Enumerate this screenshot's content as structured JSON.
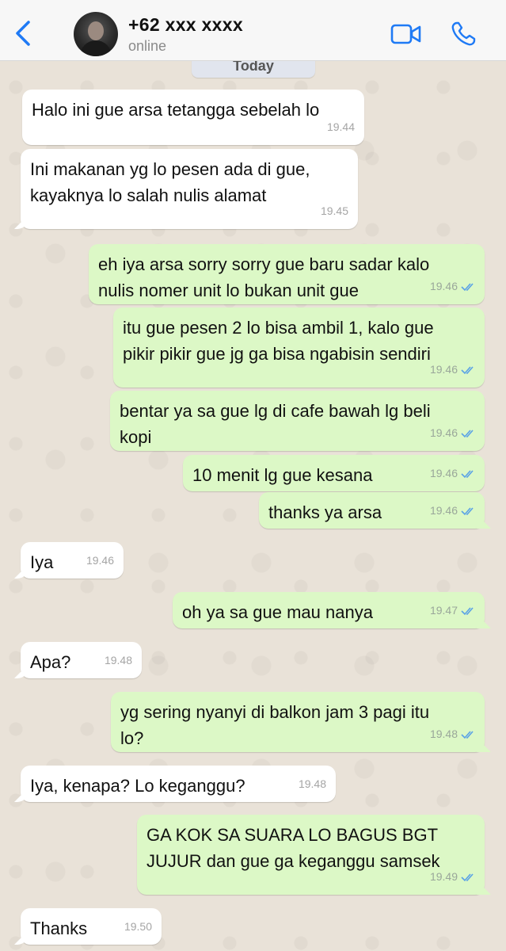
{
  "header": {
    "contact_name": "+62 xxx xxxx",
    "status": "online"
  },
  "date_label": "Today",
  "colors": {
    "accent": "#1f7af5",
    "outgoing_bubble": "#dcf8c6",
    "incoming_bubble": "#ffffff",
    "read_tick": "#5aa2e6"
  },
  "icons": [
    "back-chevron-icon",
    "video-call-icon",
    "phone-call-icon",
    "read-receipt-icon"
  ],
  "messages": [
    {
      "direction": "in",
      "text": "Halo ini gue arsa tetangga sebelah lo",
      "time": "19.44"
    },
    {
      "direction": "in",
      "text": "Ini makanan yg lo pesen ada di gue,\nkayaknya lo salah nulis alamat",
      "time": "19.45"
    },
    {
      "direction": "out",
      "text": "eh iya arsa sorry sorry gue baru sadar kalo\nnulis nomer unit lo bukan unit gue",
      "time": "19.46"
    },
    {
      "direction": "out",
      "text": "itu gue pesen 2 lo bisa ambil 1, kalo gue\npikir pikir gue jg ga bisa ngabisin sendiri",
      "time": "19.46"
    },
    {
      "direction": "out",
      "text": "bentar ya sa gue lg di cafe bawah lg beli\nkopi",
      "time": "19.46"
    },
    {
      "direction": "out",
      "text": "10 menit lg gue kesana",
      "time": "19.46"
    },
    {
      "direction": "out",
      "text": "thanks ya arsa",
      "time": "19.46"
    },
    {
      "direction": "in",
      "text": "Iya",
      "time": "19.46"
    },
    {
      "direction": "out",
      "text": "oh ya sa gue mau nanya",
      "time": "19.47"
    },
    {
      "direction": "in",
      "text": "Apa?",
      "time": "19.48"
    },
    {
      "direction": "out",
      "text": "yg sering nyanyi di balkon jam 3 pagi itu\nlo?",
      "time": "19.48"
    },
    {
      "direction": "in",
      "text": "Iya, kenapa? Lo keganggu?",
      "time": "19.48"
    },
    {
      "direction": "out",
      "text": "GA KOK SA SUARA LO BAGUS BGT\nJUJUR dan gue ga keganggu samsek",
      "time": "19.49"
    },
    {
      "direction": "in",
      "text": "Thanks",
      "time": "19.50"
    }
  ]
}
